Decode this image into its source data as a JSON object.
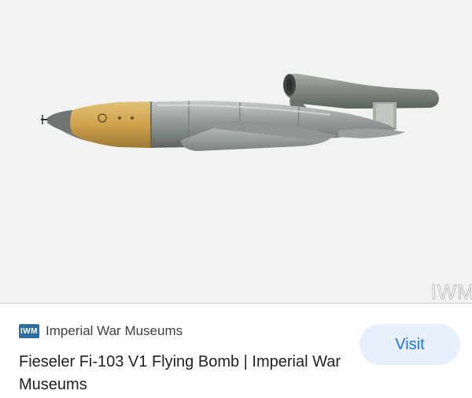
{
  "image": {
    "subject": "v1-flying-bomb-photo",
    "watermark": "IWM"
  },
  "result": {
    "source": {
      "favicon_text": "IWM",
      "name": "Imperial War Museums"
    },
    "title": "Fieseler Fi-103 V1 Flying Bomb | Imperial War Museums",
    "visit_label": "Visit"
  },
  "colors": {
    "image_background": "#f2f2f2",
    "visit_bg": "#e8f0fe",
    "visit_text": "#1a73e8",
    "favicon_bg": "#2f6f9e",
    "title_text": "#202124"
  }
}
